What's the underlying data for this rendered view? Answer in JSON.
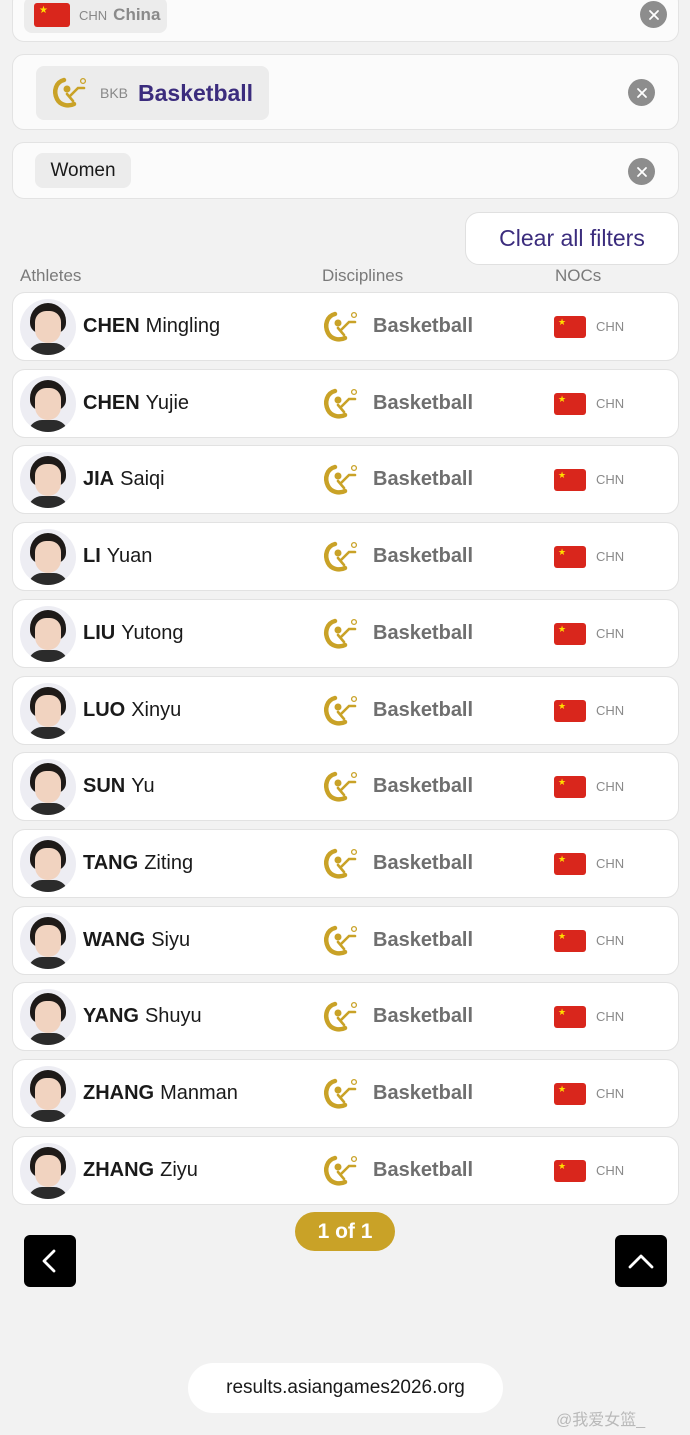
{
  "filters": {
    "country": {
      "code": "CHN",
      "name": "China"
    },
    "discipline": {
      "code": "BKB",
      "name": "Basketball"
    },
    "gender": {
      "name": "Women"
    }
  },
  "clear_all_label": "Clear all filters",
  "columns": {
    "athletes": "Athletes",
    "disciplines": "Disciplines",
    "nocs": "NOCs"
  },
  "athletes": [
    {
      "last": "CHEN",
      "first": "Mingling",
      "discipline": "Basketball",
      "noc": "CHN"
    },
    {
      "last": "CHEN",
      "first": "Yujie",
      "discipline": "Basketball",
      "noc": "CHN"
    },
    {
      "last": "JIA",
      "first": "Saiqi",
      "discipline": "Basketball",
      "noc": "CHN"
    },
    {
      "last": "LI",
      "first": "Yuan",
      "discipline": "Basketball",
      "noc": "CHN"
    },
    {
      "last": "LIU",
      "first": "Yutong",
      "discipline": "Basketball",
      "noc": "CHN"
    },
    {
      "last": "LUO",
      "first": "Xinyu",
      "discipline": "Basketball",
      "noc": "CHN"
    },
    {
      "last": "SUN",
      "first": "Yu",
      "discipline": "Basketball",
      "noc": "CHN"
    },
    {
      "last": "TANG",
      "first": "Ziting",
      "discipline": "Basketball",
      "noc": "CHN"
    },
    {
      "last": "WANG",
      "first": "Siyu",
      "discipline": "Basketball",
      "noc": "CHN"
    },
    {
      "last": "YANG",
      "first": "Shuyu",
      "discipline": "Basketball",
      "noc": "CHN"
    },
    {
      "last": "ZHANG",
      "first": "Manman",
      "discipline": "Basketball",
      "noc": "CHN"
    },
    {
      "last": "ZHANG",
      "first": "Ziyu",
      "discipline": "Basketball",
      "noc": "CHN"
    }
  ],
  "pagination": {
    "label": "1 of 1"
  },
  "url": "results.asiangames2026.org",
  "watermark": "@我爱女篮_",
  "icons": {
    "clear": "close-icon",
    "discipline": "basketball-pictogram-icon",
    "flag": "china-flag-icon",
    "back": "chevron-left-icon",
    "top": "chevron-up-icon"
  },
  "colors": {
    "accent_purple": "#3b2c7d",
    "gold": "#c9a227",
    "flag_red": "#d9261c",
    "flag_star": "#ffde00"
  }
}
